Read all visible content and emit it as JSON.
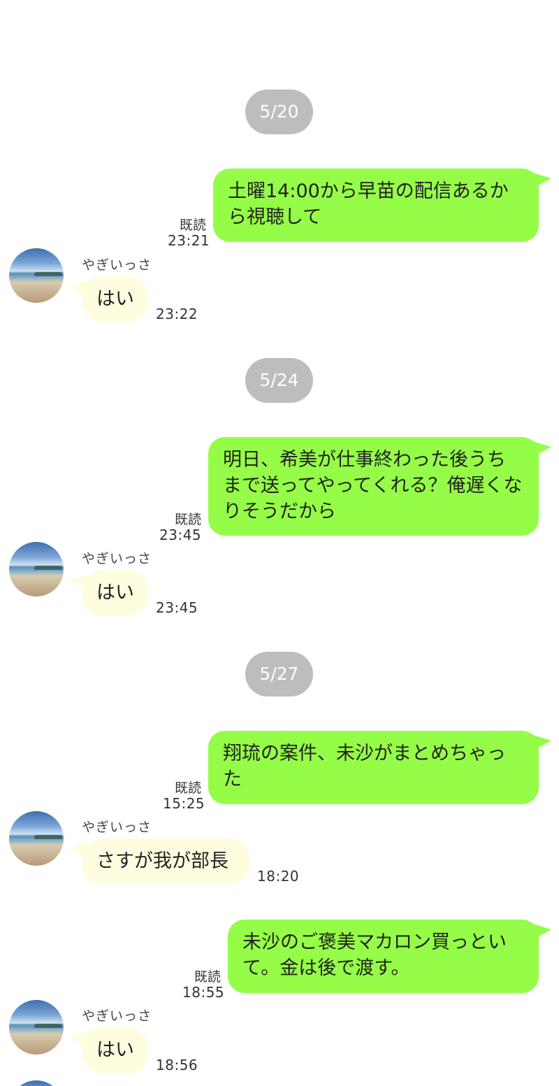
{
  "conversation": {
    "days": [
      {
        "date": "5/20",
        "sent": {
          "text": "土曜14:00から早苗の配信あるから視聴して",
          "read": "既読",
          "time": "23:21"
        },
        "reply": {
          "sender": "やぎいっさ",
          "text": "はい",
          "time": "23:22"
        }
      },
      {
        "date": "5/24",
        "sent": {
          "text": "明日、希美が仕事終わった後うちまで送ってやってくれる？俺遅くなりそうだから",
          "read": "既読",
          "time": "23:45"
        },
        "reply": {
          "sender": "やぎいっさ",
          "text": "はい",
          "time": "23:45"
        }
      },
      {
        "date": "5/27",
        "sent": {
          "text": "翔琉の案件、未沙がまとめちゃった",
          "read": "既読",
          "time": "15:25"
        },
        "reply": {
          "sender": "やぎいっさ",
          "text": "さすが我が部長",
          "time": "18:20"
        },
        "sent2": {
          "text": "未沙のご褒美マカロン買っといて。金は後で渡す。",
          "read": "既読",
          "time": "18:55"
        },
        "reply2": {
          "sender": "やぎいっさ",
          "text": "はい",
          "time": "18:56"
        }
      }
    ]
  },
  "colors": {
    "sent_bubble": "#95fd48",
    "received_bubble": "#fffde0",
    "date_pill": "#bdbdbd"
  },
  "icons": {
    "avatar": "beach-photo-avatar"
  }
}
